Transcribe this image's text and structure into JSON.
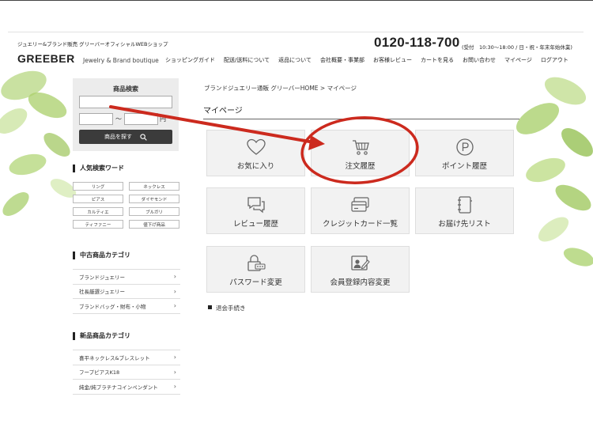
{
  "header": {
    "tagline": "ジュエリー&ブランド販売 グリーバーオフィシャルWEBショップ",
    "phone": "0120-118-700",
    "hours": "(受付　10:30〜18:00 / 日・祝・年末年始休業)",
    "logo": "GREEBER",
    "logo_sub": "Jewelry & Brand boutique",
    "nav": [
      "ショッピングガイド",
      "配送/送料について",
      "返品について",
      "会社概要・事業部",
      "お客様レビュー",
      "カートを見る",
      "お問い合わせ",
      "マイページ",
      "ログアウト"
    ]
  },
  "search": {
    "title": "商品検索",
    "input_value": "",
    "tilde": "〜",
    "yen": "円",
    "button_label": "商品を探す"
  },
  "popular": {
    "title": "人気検索ワード",
    "words": [
      "リング",
      "ネックレス",
      "ピアス",
      "ダイヤモンド",
      "カルティエ",
      "ブルガリ",
      "ティファニー",
      "値下げ商品"
    ]
  },
  "used_categories": {
    "title": "中古商品カテゴリ",
    "items": [
      "ブランドジュエリー",
      "社長厳選ジュエリー",
      "ブランドバッグ・財布・小物"
    ]
  },
  "new_categories": {
    "title": "新品商品カテゴリ",
    "items": [
      "喜平ネックレス&ブレスレット",
      "フープピアスK18",
      "純金/純プラチナコインペンダント"
    ]
  },
  "main": {
    "breadcrumb": "ブランドジュエリー通販 グリーバーHOME > マイページ",
    "title": "マイページ",
    "tiles": [
      {
        "label": "お気に入り",
        "icon": "heart-icon"
      },
      {
        "label": "注文履歴",
        "icon": "cart-icon"
      },
      {
        "label": "ポイント履歴",
        "icon": "point-icon"
      },
      {
        "label": "レビュー履歴",
        "icon": "speech-bubbles-icon"
      },
      {
        "label": "クレジットカード一覧",
        "icon": "credit-card-icon"
      },
      {
        "label": "お届け先リスト",
        "icon": "address-book-icon"
      },
      {
        "label": "パスワード変更",
        "icon": "lock-icon"
      },
      {
        "label": "会員登録内容変更",
        "icon": "profile-edit-icon"
      }
    ],
    "withdraw": "退会手続き"
  },
  "colors": {
    "annotation": "#cc2a1e",
    "tile_bg": "#f2f2f2",
    "button_dark": "#3b3b3b"
  }
}
